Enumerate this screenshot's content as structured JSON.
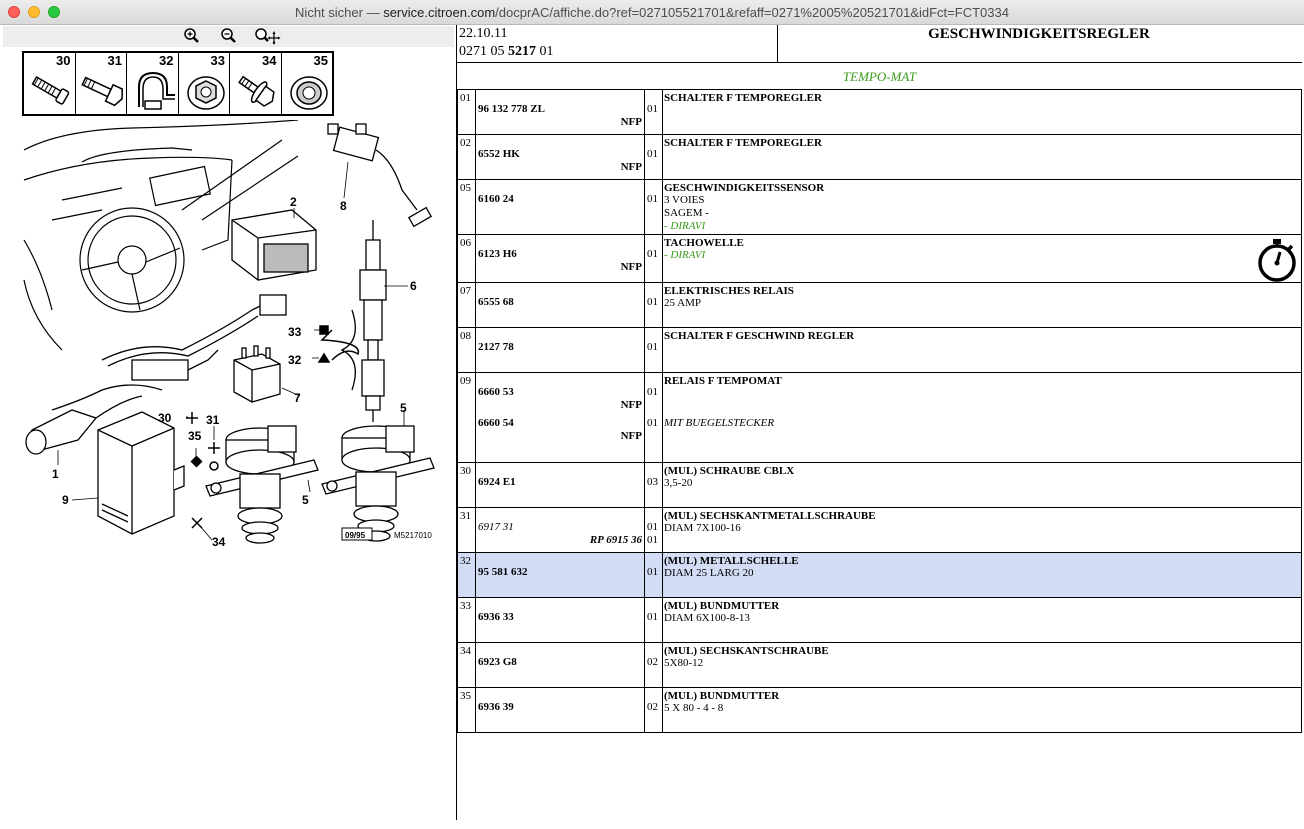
{
  "window": {
    "prefix": "Nicht sicher — ",
    "domain": "service.citroen.com",
    "path": "/docprAC/affiche.do?ref=027105521701&refaff=0271%2005%20521701&idFct=FCT0334"
  },
  "zoom_toolbar": {
    "icons": [
      "zoom-in-icon",
      "zoom-out-icon",
      "zoom-pan-icon"
    ]
  },
  "parts_strip": {
    "numbers": [
      "30",
      "31",
      "32",
      "33",
      "34",
      "35"
    ]
  },
  "diagram": {
    "callouts": [
      "1",
      "2",
      "5",
      "5",
      "6",
      "7",
      "8",
      "9",
      "30",
      "31",
      "32",
      "33",
      "34",
      "35"
    ],
    "stamp": "09/95",
    "figure_id": "M5217010"
  },
  "header": {
    "date": "22.10.11",
    "ref_prefix": "0271 05 ",
    "ref_bold": "5217",
    "ref_suffix": " 01",
    "title": "GESCHWINDIGKEITSREGLER",
    "subtitle": "TEMPO-MAT"
  },
  "colors": {
    "green_text": "#3a9a1a",
    "selected_row": "#d3dcf5"
  },
  "rows": [
    {
      "pos": "01",
      "ref": "96 132 778 ZL",
      "nfp": "NFP",
      "qty": "01",
      "title": "SCHALTER F TEMPOREGLER",
      "lines": []
    },
    {
      "pos": "02",
      "ref": "6552 HK",
      "nfp": "NFP",
      "qty": "01",
      "title": "SCHALTER F TEMPOREGLER",
      "lines": []
    },
    {
      "pos": "05",
      "ref": "6160 24",
      "nfp": "",
      "qty": "01",
      "title": "GESCHWINDIGKEITSSENSOR",
      "lines": [
        "3 VOIES",
        "SAGEM -"
      ],
      "green": "- DIRAVI"
    },
    {
      "pos": "06",
      "ref": "6123 H6",
      "nfp": "NFP",
      "qty": "01",
      "title": "TACHOWELLE",
      "lines": [],
      "green": "- DIRAVI",
      "stopwatch": true
    },
    {
      "pos": "07",
      "ref": "6555 68",
      "nfp": "",
      "qty": "01",
      "title": "ELEKTRISCHES RELAIS",
      "lines": [
        "25 AMP"
      ]
    },
    {
      "pos": "08",
      "ref": "2127 78",
      "nfp": "",
      "qty": "01",
      "title": "SCHALTER F GESCHWIND REGLER",
      "lines": []
    },
    {
      "pos": "09",
      "ref": "6660 53",
      "nfp": "NFP",
      "qty": "01",
      "ref2": "6660 54",
      "nfp2": "NFP",
      "qty2": "01",
      "title": "RELAIS F TEMPOMAT",
      "lines": [],
      "italic2": "MIT BUEGELSTECKER"
    },
    {
      "pos": "30",
      "ref": "6924 E1",
      "nfp": "",
      "qty": "03",
      "title": "(MUL) SCHRAUBE CBLX",
      "lines": [
        "3,5-20"
      ]
    },
    {
      "pos": "31",
      "ref_it": "6917 31",
      "rp": "RP 6915 36",
      "qty": "01",
      "qty2": "01",
      "title": "(MUL) SECHSKANTMETALLSCHRAUBE",
      "lines": [
        "DIAM 7X100-16"
      ]
    },
    {
      "pos": "32",
      "ref": "95 581 632",
      "nfp": "",
      "qty": "01",
      "title": "(MUL) METALLSCHELLE",
      "lines": [
        "DIAM 25 LARG 20"
      ],
      "selected": true
    },
    {
      "pos": "33",
      "ref": "6936 33",
      "nfp": "",
      "qty": "01",
      "title": "(MUL) BUNDMUTTER",
      "lines": [
        "DIAM 6X100-8-13"
      ]
    },
    {
      "pos": "34",
      "ref": "6923 G8",
      "nfp": "",
      "qty": "02",
      "title": "(MUL) SECHSKANTSCHRAUBE",
      "lines": [
        "5X80-12"
      ]
    },
    {
      "pos": "35",
      "ref": "6936 39",
      "nfp": "",
      "qty": "02",
      "title": "(MUL) BUNDMUTTER",
      "lines": [
        "5 X 80 - 4 - 8"
      ]
    }
  ]
}
